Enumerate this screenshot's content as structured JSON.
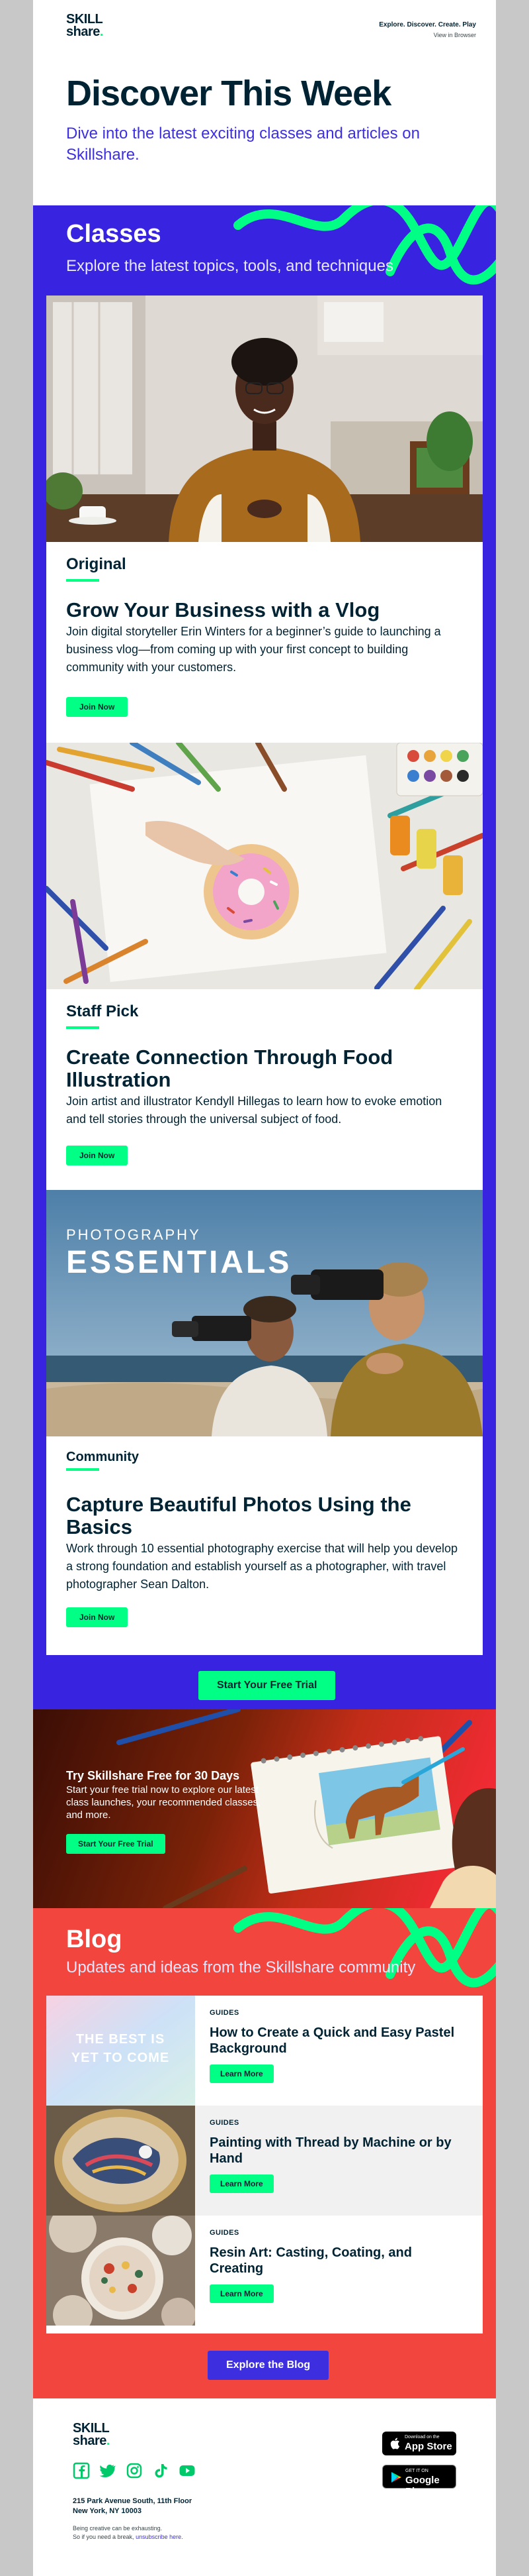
{
  "header": {
    "logo_line1": "SKILL",
    "logo_line2": "share",
    "logo_dot": ".",
    "tagline": "Explore. Discover. Create. Play",
    "view_in_browser": "View in Browser",
    "headline": "Discover This Week",
    "subheadline": "Dive into the latest exciting classes and articles on Skillshare."
  },
  "classes": {
    "title": "Classes",
    "subtitle": "Explore the latest topics, tools, and techniques",
    "cards": [
      {
        "badge": "Original",
        "title": "Grow Your Business with a Vlog",
        "description": "Join digital storyteller Erin Winters for a beginner’s guide to launching a business vlog—from coming up with your first concept to building community with your customers.",
        "button": "Join Now"
      },
      {
        "badge": "Staff Pick",
        "title": "Create Connection Through Food Illustration",
        "description": "Join artist and illustrator Kendyll Hillegas to learn how to evoke emotion and tell stories through the universal subject of food.",
        "button": "Join Now"
      },
      {
        "badge": "Community",
        "title": "Capture Beautiful Photos Using the Basics",
        "description": "Work through 10 essential photography exercise that will help you develop a strong foundation and establish yourself as a photographer, with travel photographer Sean Dalton.",
        "button": "Join Now",
        "image_text_1": "PHOTOGRAPHY",
        "image_text_2": "ESSENTIALS"
      }
    ],
    "cta": "Start Your Free Trial"
  },
  "trial": {
    "title": "Try Skillshare Free for 30 Days",
    "description": "Start your free trial now to explore our latest class launches, your recommended classes, and more.",
    "button": "Start Your Free Trial"
  },
  "blog": {
    "title": "Blog",
    "subtitle": "Updates and ideas from the Skillshare community",
    "items": [
      {
        "tag": "GUIDES",
        "title": "How to Create a Quick and Easy Pastel Background",
        "button": "Learn More",
        "thumb_text_1": "THE BEST IS",
        "thumb_text_2": "YET TO COME"
      },
      {
        "tag": "GUIDES",
        "title": "Painting with Thread by Machine or by Hand",
        "button": "Learn More"
      },
      {
        "tag": "GUIDES",
        "title": "Resin Art: Casting, Coating, and Creating",
        "button": "Learn More"
      }
    ],
    "cta": "Explore the Blog"
  },
  "footer": {
    "address_line1": "215 Park Avenue South, 11th Floor",
    "address_line2": "New York, NY 10003",
    "fine_line1": "Being creative can be exhausting.",
    "fine_line2_prefix": "So if you need a break, ",
    "fine_link": "unsubscribe here",
    "fine_suffix": ".",
    "app_store_small": "Download on the",
    "app_store_big": "App Store",
    "google_play_small": "GET IT ON",
    "google_play_big": "Google Play",
    "social_icons": [
      "facebook-icon",
      "twitter-icon",
      "instagram-icon",
      "tiktok-icon",
      "youtube-icon"
    ]
  },
  "colors": {
    "brand_navy": "#002333",
    "brand_green": "#00ff84",
    "classes_bg": "#3824e0",
    "blog_bg": "#f2453d",
    "link_purple": "#3d2fe0"
  }
}
